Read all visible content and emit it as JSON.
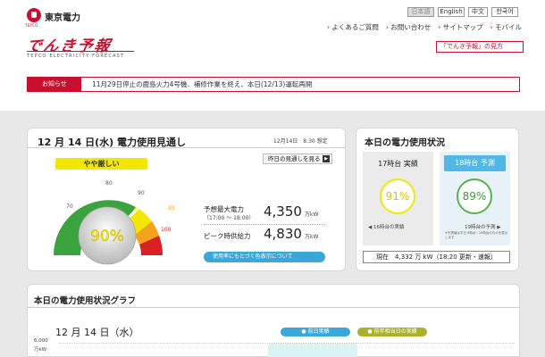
{
  "header": {
    "company": "東京電力",
    "logo_sub": "TEPCO",
    "brand": "でんき予報",
    "brand_sub": "TEPCO ELECTRICITY FORECAST",
    "languages": [
      "日本語",
      "English",
      "中文",
      "한국어"
    ],
    "nav": [
      "よくあるご質問",
      "お問い合わせ",
      "サイトマップ",
      "モバイル"
    ],
    "howto": "「でんき予報」の見方"
  },
  "notice": {
    "label": "お知らせ",
    "text": "11月29日停止の鹿島火力4号機、補修作業を終え、本日(12/13)運転再開"
  },
  "forecast": {
    "title": "12 月 14 日(水) 電力使用見通し",
    "asof": "12月14日　8:30 想定",
    "yesterday_button": "昨日の見通しを見る",
    "status": "やや厳しい",
    "gauge_value": "90%",
    "gauge_percent": 90,
    "gauge_ticks": [
      "70",
      "80",
      "90",
      "95",
      "100"
    ],
    "max_demand_label": "予想最大電力",
    "max_demand_sub": "（17:00 ～ 18:00）",
    "max_demand_value": "4,350",
    "max_demand_unit": "万kW",
    "peak_supply_label": "ピーク時供給力",
    "peak_supply_value": "4,830",
    "peak_supply_unit": "万kW",
    "color_button": "使用率にもとづく色表示について"
  },
  "today_status": {
    "title": "本日の電力使用状況",
    "actual_head": "17時台 実績",
    "actual_value": "91%",
    "actual_note": "◀ 16時台の実績",
    "forecast_head": "18時台 予測",
    "forecast_value": "89%",
    "forecast_note": "19時台の予測 ▶",
    "forecast_fine": "※予測値は平日 9時台・20時台のものを表示します",
    "current": "現在　4,332 万 kW（18:20 更新・速報）"
  },
  "graph": {
    "title": "本日の電力使用状況グラフ",
    "date": "12 月 14 日（水）",
    "ytick": "6,000",
    "yunit": "万kW",
    "prev_button": "● 前日実績",
    "last_year_button": "● 前年相当日の実績"
  },
  "colors": {
    "accent_red": "#c8102e",
    "status_yellow": "#f3e600",
    "ok_green": "#55b34a",
    "link_blue": "#3aa7d9"
  }
}
